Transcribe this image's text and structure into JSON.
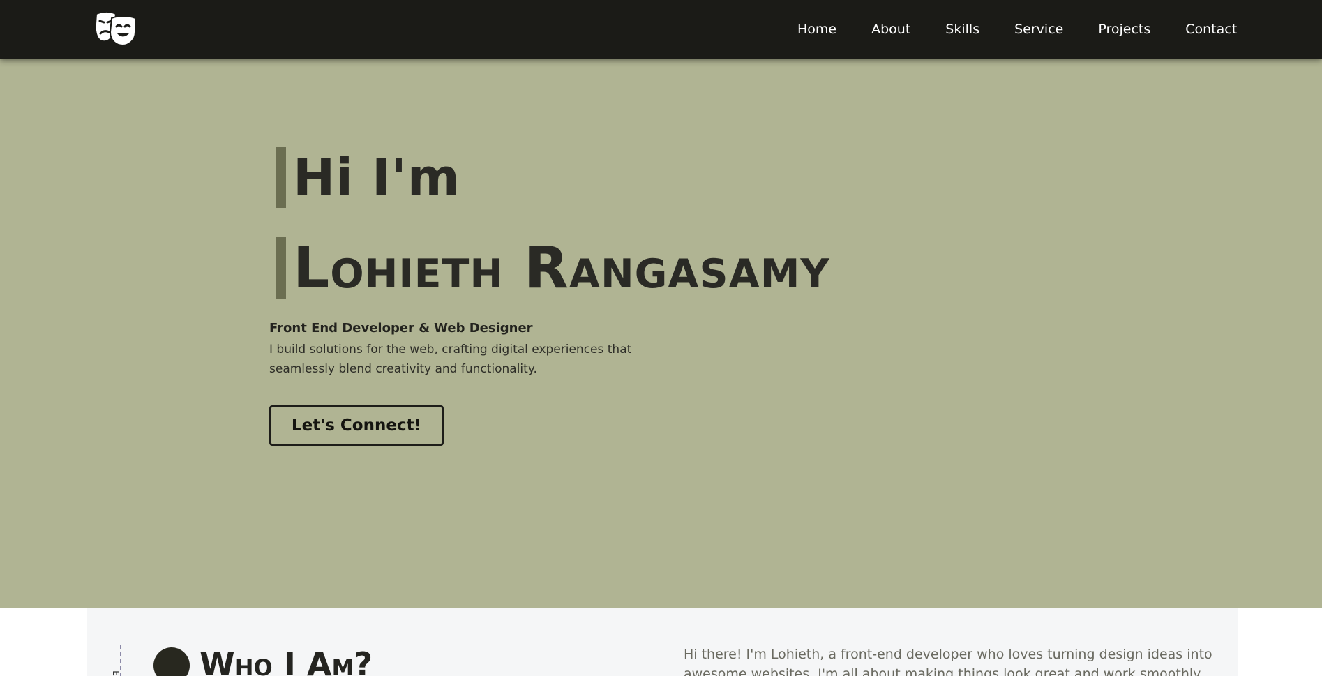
{
  "nav": {
    "logo_icon": "theater-masks-icon",
    "links": [
      "Home",
      "About",
      "Skills",
      "Service",
      "Projects",
      "Contact"
    ]
  },
  "hero": {
    "greeting": "Hi I'm",
    "name": "Lohieth Rangasamy",
    "role": "Front End Developer & Web Designer",
    "description": "I build solutions for the web, crafting digital experiences that seamlessly blend creativity and functionality.",
    "cta_label": "Let's Connect!"
  },
  "about": {
    "title": "Who I Am?",
    "side_label": "E",
    "intro": "Hi there! I'm Lohieth, a front-end developer who loves turning design ideas into awesome websites. I'm all about making things look great and work smoothly. From"
  },
  "colors": {
    "navbar_bg": "#1b1b17",
    "hero_bg": "#b0b493",
    "accent_bar": "#6b6e51",
    "about_bg": "#f5f6f7"
  }
}
